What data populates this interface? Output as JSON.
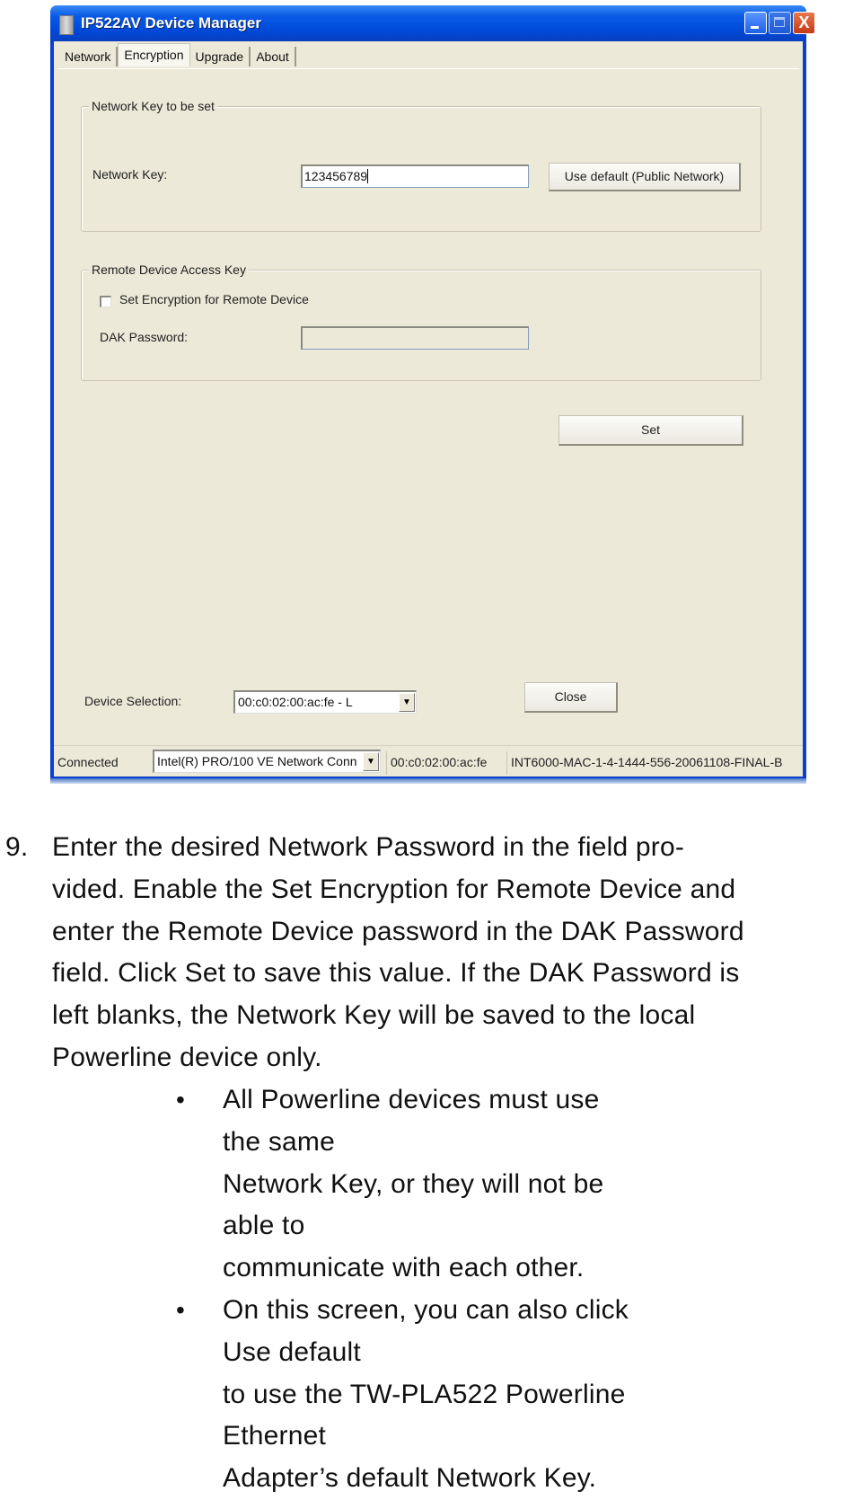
{
  "window": {
    "title": "IP522AV Device Manager",
    "controls": {
      "minimize": "minimize",
      "maximize": "maximize",
      "close": "X"
    },
    "tabs": [
      {
        "label": "Network",
        "active": false
      },
      {
        "label": "Encryption",
        "active": true
      },
      {
        "label": "Upgrade",
        "active": false
      },
      {
        "label": "About",
        "active": false
      }
    ],
    "network_key_group": {
      "legend": "Network Key to be set",
      "network_key_label": "Network Key:",
      "network_key_value": "123456789",
      "use_default_button": "Use default (Public Network)"
    },
    "remote_group": {
      "legend": "Remote Device Access Key",
      "checkbox_label": "Set Encryption for Remote Device",
      "checkbox_checked": false,
      "dak_label": "DAK Password:",
      "dak_value": ""
    },
    "set_button": "Set",
    "device_selection_label": "Device Selection:",
    "device_selection_value": "00:c0:02:00:ac:fe - L",
    "close_button": "Close",
    "status_bar": {
      "status": "Connected",
      "adapter": "Intel(R) PRO/100 VE Network Conn",
      "mac": "00:c0:02:00:ac:fe",
      "firmware": "INT6000-MAC-1-4-1444-556-20061108-FINAL-B"
    }
  },
  "document": {
    "step_number": "9.",
    "step_lines": [
      "Enter the desired Network Password in the field pro-",
      "vided. Enable the Set Encryption for Remote Device and",
      "enter the Remote Device password in the DAK Password",
      "field. Click Set to save this value. If the DAK Password is",
      "left blanks, the Network Key will be saved to the local",
      "Powerline device only."
    ],
    "bullets": [
      {
        "symbol": "•",
        "lines": [
          "All Powerline devices must use the same",
          "Network Key, or they will not be able to",
          "communicate with each other."
        ]
      },
      {
        "symbol": "•",
        "lines": [
          "On this screen, you can also click Use default",
          "to use the TW-PLA522 Powerline Ethernet",
          "Adapter’s default Network Key."
        ]
      }
    ]
  },
  "colors": {
    "titlebar_blue": "#0049d8",
    "dialog_background": "#ece9d8",
    "close_red": "#c43a16"
  }
}
